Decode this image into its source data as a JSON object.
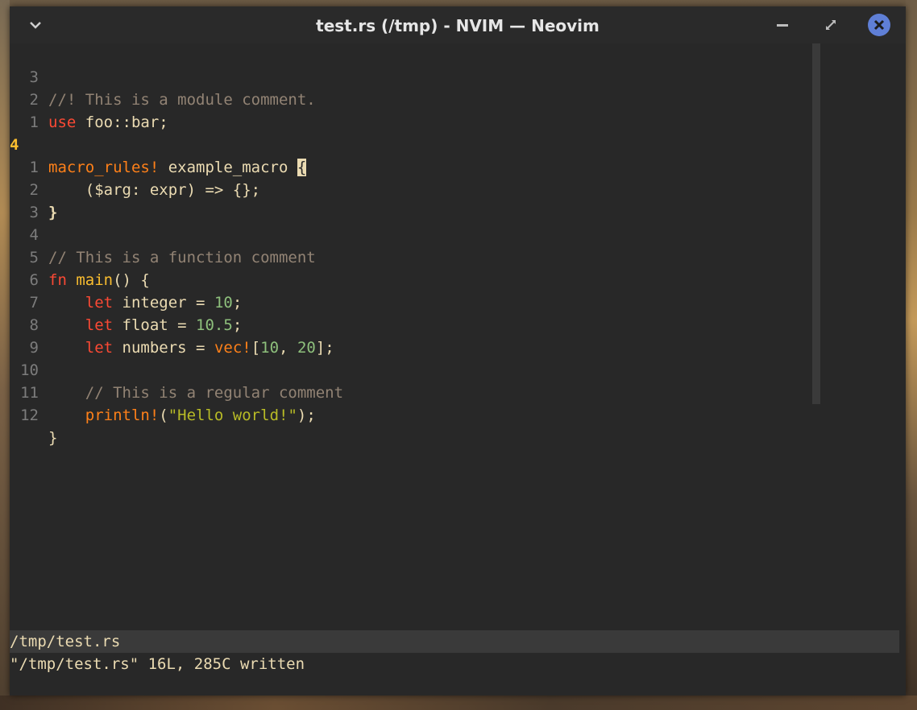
{
  "window": {
    "title": "test.rs (/tmp) - NVIM — Neovim",
    "menu_icon": "chevron-down-icon",
    "minimize_icon": "minimize-icon",
    "maximize_icon": "restore-icon",
    "close_icon": "close-icon",
    "close_color": "#5f7fd6"
  },
  "editor": {
    "current_line_number": "4",
    "lines": [
      {
        "num": "3",
        "text": "//! This is a module comment."
      },
      {
        "num": "2",
        "text": "use foo::bar;"
      },
      {
        "num": "1",
        "text": ""
      },
      {
        "num": "4",
        "text": "macro_rules! example_macro {"
      },
      {
        "num": "1",
        "text": "    ($arg: expr) => {};"
      },
      {
        "num": "2",
        "text": "}"
      },
      {
        "num": "3",
        "text": ""
      },
      {
        "num": "4",
        "text": "// This is a function comment"
      },
      {
        "num": "5",
        "text": "fn main() {"
      },
      {
        "num": "6",
        "text": "    let integer = 10;"
      },
      {
        "num": "7",
        "text": "    let float = 10.5;"
      },
      {
        "num": "8",
        "text": "    let numbers = vec![10, 20];"
      },
      {
        "num": "9",
        "text": ""
      },
      {
        "num": "10",
        "text": "    // This is a regular comment"
      },
      {
        "num": "11",
        "text": "    println!(\"Hello world!\");"
      },
      {
        "num": "12",
        "text": "}"
      }
    ],
    "tokens": {
      "l0": "//! This is a module comment.",
      "l1_kw": "use",
      "l1_rest": " foo::bar;",
      "l3_mac": "macro_rules!",
      "l3_name": " example_macro ",
      "l3_brace": "{",
      "l4": "    ($arg: expr) => {};",
      "l5": "}",
      "l7": "// This is a function comment",
      "l8_kw": "fn",
      "l8_sp": " ",
      "l8_fn": "main",
      "l8_rest": "() {",
      "l9_ind": "    ",
      "l9_kw": "let",
      "l9_mid": " integer = ",
      "l9_num": "10",
      "l9_end": ";",
      "l10_kw": "let",
      "l10_mid": " float = ",
      "l10_num": "10.5",
      "l10_end": ";",
      "l11_kw": "let",
      "l11_mid": " numbers = ",
      "l11_mac": "vec!",
      "l11_br": "[",
      "l11_n1": "10",
      "l11_comma": ", ",
      "l11_n2": "20",
      "l11_end": "];",
      "l13": "    // This is a regular comment",
      "l14_ind": "    ",
      "l14_mac": "println!",
      "l14_p": "(",
      "l14_str": "\"Hello world!\"",
      "l14_end": ");",
      "l15": "}"
    }
  },
  "statusline": {
    "file": "/tmp/test.rs"
  },
  "cmdline": {
    "message": "\"/tmp/test.rs\" 16L, 285C written"
  }
}
